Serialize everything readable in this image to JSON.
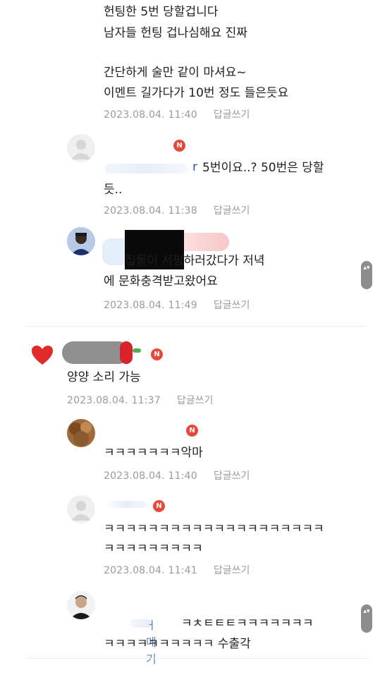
{
  "comments": [
    {
      "id": "c1",
      "lines": [
        "헌팅한 5번 당할겁니다",
        "남자들 헌팅 겁나심해요 진짜",
        "",
        "간단하게 술만 같이 마셔요~",
        "이멘트 길가다가 10번 정도 들은듯요"
      ],
      "date": "2023.08.04. 11:40",
      "reply_label": "답글쓰기"
    },
    {
      "id": "c2",
      "name_fragment": "r",
      "lines": [
        "5번이요..? 50번은 당할",
        "듯.."
      ],
      "badge": "N",
      "date": "2023.08.04. 11:38",
      "reply_label": "답글쓰기"
    },
    {
      "id": "c3",
      "lines": [
        "집돌이 서핑하러갔다가 저녁",
        "에 문화충격받고왔어요"
      ],
      "date": "2023.08.04. 11:49",
      "reply_label": "답글쓰기"
    },
    {
      "id": "c4",
      "lines": [
        "양양 소리 가능"
      ],
      "badge": "N",
      "date": "2023.08.04. 11:37",
      "reply_label": "답글쓰기"
    },
    {
      "id": "c5",
      "lines": [
        "ㅋㅋㅋㅋㅋㅋㅋ악마"
      ],
      "badge": "N",
      "date": "2023.08.04. 11:40",
      "reply_label": "답글쓰기"
    },
    {
      "id": "c6",
      "lines": [
        "ㅋㅋㅋㅋㅋㅋㅋㅋㅋㅋㅋㅋㅋㅋㅋㅋㅋㅋㅋㅋ",
        "ㅋㅋㅋㅋㅋㅋㅋㅋㅋ"
      ],
      "badge": "N",
      "date": "2023.08.04. 11:41",
      "reply_label": "답글쓰기"
    },
    {
      "id": "c7",
      "name_fragment": "ㅓ메기",
      "lines": [
        "ㅋㅊㅌㅌㅌㅋㅋㅋㅋㅋㅋㅋ",
        "ㅋㅋㅋㅋㅋㅋㅋㅋㅋㅋ 수출각"
      ]
    }
  ],
  "icons": {
    "heart": "heart-icon",
    "scroll_arrows": "▴▾"
  },
  "colors": {
    "badge": "#e8483a",
    "heart": "#e02a2a",
    "meta": "#9a9a9a"
  }
}
